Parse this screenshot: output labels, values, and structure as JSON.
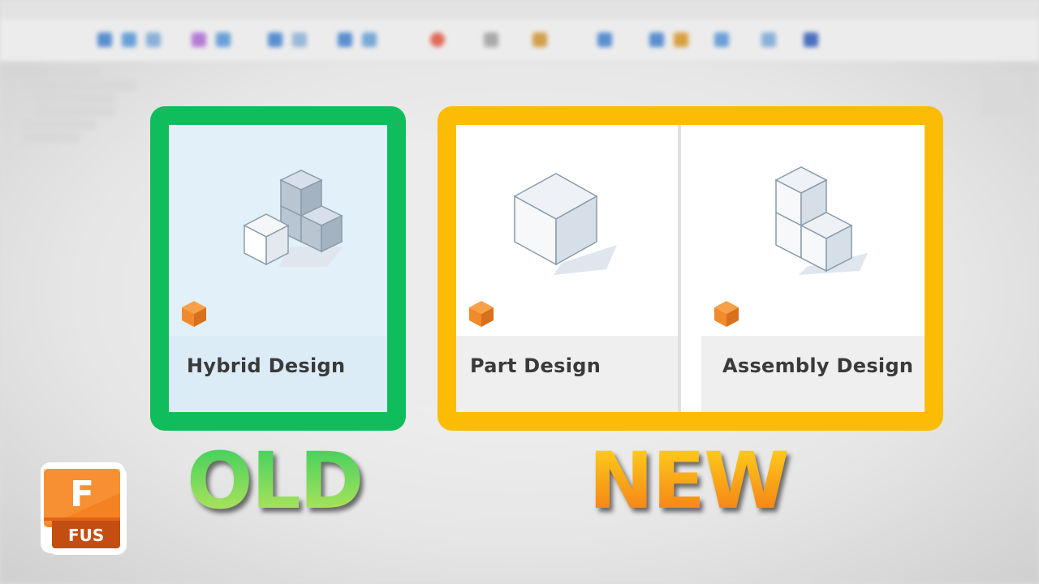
{
  "cards": {
    "old": {
      "label": "Hybrid Design",
      "frame_color": "#0fbd5c"
    },
    "part": {
      "label": "Part Design"
    },
    "assembly": {
      "label": "Assembly Design"
    },
    "new_frame_color": "#fcbc05"
  },
  "captions": {
    "old": "OLD",
    "new": "NEW"
  },
  "logo": {
    "letter": "F",
    "tag": "FUS",
    "icon": "autodesk-fusion-icon"
  },
  "colors": {
    "badge": "#f28a2b",
    "hybrid_bg": "#e2f0f9",
    "footer_bg": "#efefef"
  }
}
